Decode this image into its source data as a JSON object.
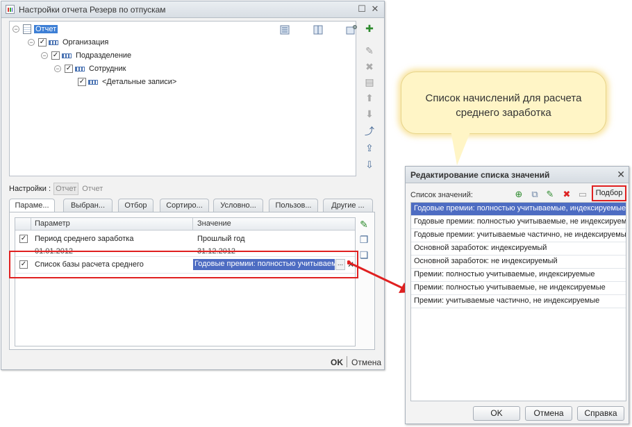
{
  "main_window": {
    "title": "Настройки отчета  Резерв по отпускам",
    "tree": {
      "root": "Отчет",
      "nodes": [
        "Организация",
        "Подразделение",
        "Сотрудник",
        "<Детальные записи>"
      ]
    },
    "settings_label": "Настройки :",
    "settings_value": "Отчет",
    "settings_value2": "Отчет",
    "tabs": [
      "Параме...",
      "Выбран...",
      "Отбор",
      "Сортиро...",
      "Условно...",
      "Пользов...",
      "Другие ..."
    ],
    "table": {
      "col_param": "Параметр",
      "col_value": "Значение",
      "rows": [
        {
          "param": "Период среднего заработка",
          "value": "Прошлый год",
          "date_from": "01.01.2012",
          "date_to": "31.12.2012"
        },
        {
          "param": "Список базы расчета среднего",
          "value": "Годовые премии: полностью учитываемые, индексируемые"
        }
      ],
      "dots": "..."
    },
    "ok": "OK",
    "cancel": "Отмена"
  },
  "callout": {
    "line1": "Список начислений для расчета",
    "line2": "среднего заработка"
  },
  "dialog": {
    "title": "Редактирование списка значений",
    "list_label": "Список значений:",
    "podbor": "Подбор",
    "items": [
      "Годовые премии: полностью учитываемые, индексируемые",
      "Годовые премии: полностью учитываемые, не индексируемые",
      "Годовые премии: учитываемые частично, не индексируемые",
      "Основной заработок: индексируемый",
      "Основной заработок: не индексируемый",
      "Премии: полностью учитываемые, индексируемые",
      "Премии: полностью учитываемые, не индексируемые",
      "Премии: учитываемые частично, не индексируемые"
    ],
    "ok": "OK",
    "cancel": "Отмена",
    "help": "Справка"
  },
  "colors": {
    "highlight": "#e02020",
    "selection": "#4d6cc2"
  }
}
